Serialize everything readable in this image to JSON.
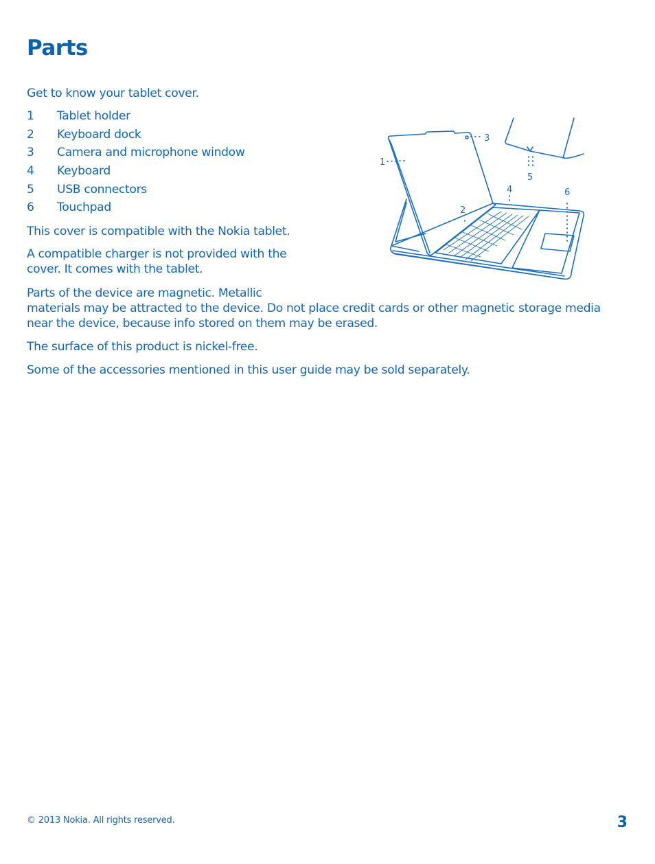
{
  "page": {
    "title": "Parts",
    "intro": "Get to know your tablet cover.",
    "parts": [
      {
        "number": "1",
        "label": "Tablet holder"
      },
      {
        "number": "2",
        "label": "Keyboard dock"
      },
      {
        "number": "3",
        "label": "Camera and microphone window"
      },
      {
        "number": "4",
        "label": "Keyboard"
      },
      {
        "number": "5",
        "label": "USB connectors"
      },
      {
        "number": "6",
        "label": "Touchpad"
      }
    ],
    "paragraphs": {
      "compatible": "This cover is compatible with the Nokia tablet.",
      "charger_line1": "A compatible charger is not provided with the",
      "charger_line2": "cover. It comes with the tablet.",
      "magnetic_line1": "Parts of the device are magnetic. Metallic",
      "magnetic_line2": "materials may be attracted to the device. Do not place credit cards or other magnetic storage media",
      "magnetic_line3": "near the device, because info stored on them may be erased.",
      "nickel": "The surface of this product is nickel-free.",
      "accessories": "Some of the accessories mentioned in this user guide may be sold separately."
    },
    "figure_callouts": [
      "1",
      "2",
      "3",
      "4",
      "5",
      "6"
    ],
    "footer": {
      "copyright": "© 2013 Nokia. All rights reserved.",
      "page_number": "3"
    }
  }
}
